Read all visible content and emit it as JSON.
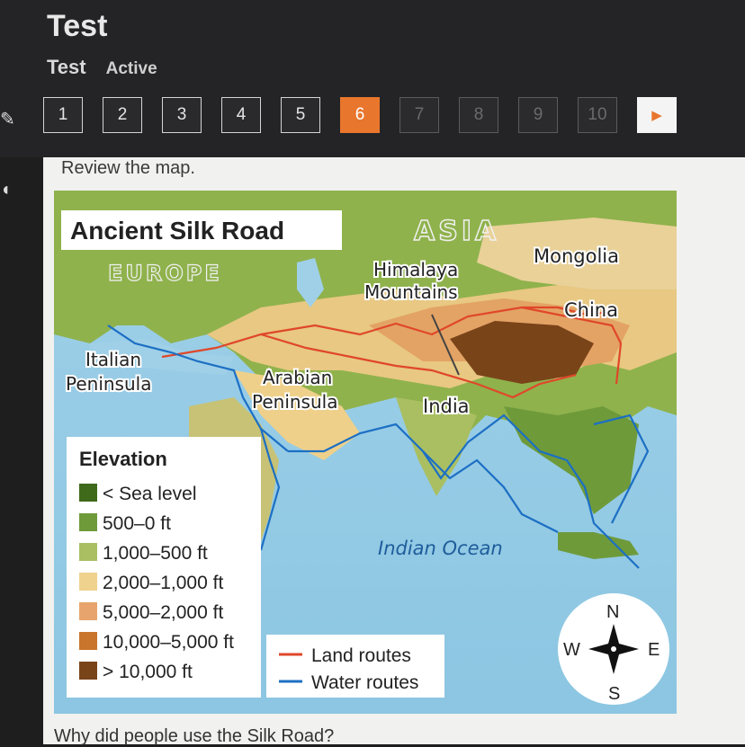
{
  "header": {
    "title": "Test",
    "subtab_test": "Test",
    "subtab_active": "Active"
  },
  "nav": {
    "questions": [
      "1",
      "2",
      "3",
      "4",
      "5",
      "6",
      "7",
      "8",
      "9",
      "10"
    ],
    "current": "6",
    "next_icon": "play-arrow-icon"
  },
  "content": {
    "prompt": "Review the map.",
    "question": "Why did people use the Silk Road?"
  },
  "map": {
    "title": "Ancient Silk Road",
    "regions": {
      "asia": "ASIA",
      "europe": "EUROPE",
      "mongolia": "Mongolia",
      "himalaya_1": "Himalaya",
      "himalaya_2": "Mountains",
      "china": "China",
      "italian_1": "Italian",
      "italian_2": "Peninsula",
      "arabian_1": "Arabian",
      "arabian_2": "Peninsula",
      "india": "India",
      "ocean": "Indian Ocean"
    },
    "legend": {
      "title": "Elevation",
      "items": [
        {
          "label": "< Sea level",
          "color": "#3f6a1a"
        },
        {
          "label": "500–0 ft",
          "color": "#6e9a3a"
        },
        {
          "label": "1,000–500 ft",
          "color": "#a9bf62"
        },
        {
          "label": "2,000–1,000 ft",
          "color": "#efd28e"
        },
        {
          "label": "5,000–2,000 ft",
          "color": "#e7a56d"
        },
        {
          "label": "10,000–5,000 ft",
          "color": "#c9752b"
        },
        {
          "label": "> 10,000 ft",
          "color": "#7a4419"
        }
      ],
      "land_routes": "Land routes",
      "water_routes": "Water routes",
      "land_color": "#e0472a",
      "water_color": "#1c6fc4"
    },
    "compass": {
      "n": "N",
      "s": "S",
      "e": "E",
      "w": "W"
    }
  }
}
